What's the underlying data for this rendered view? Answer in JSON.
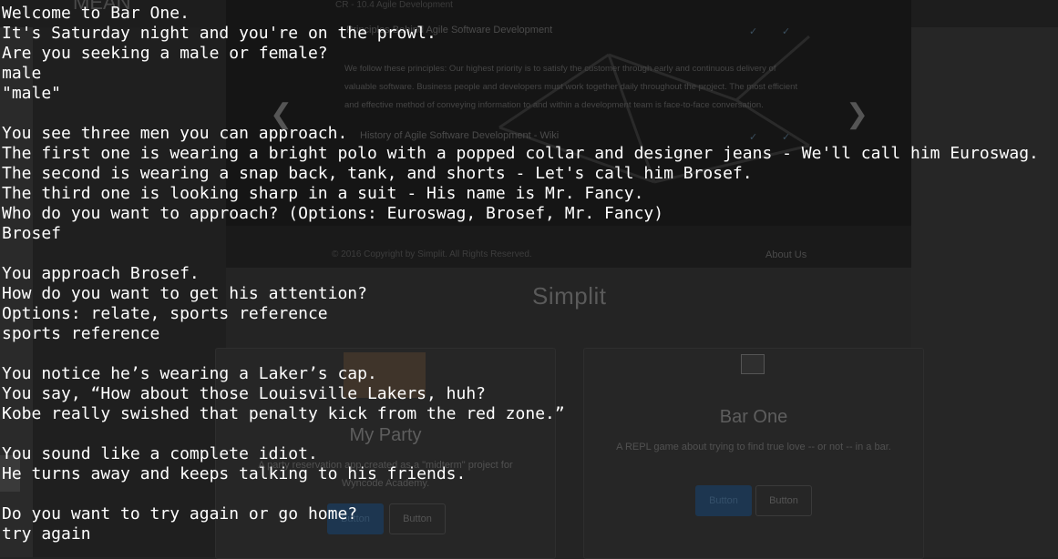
{
  "background": {
    "top_logo": "MEAN",
    "carousel": {
      "small_text": "CR - 10.4 Agile Development",
      "title": "Principles Behind Agile Software Development",
      "body": "We follow these principles: Our highest priority is to satisfy the customer through early and continuous delivery of valuable software. Business people and developers must work together daily throughout the project. The most efficient and effective method of conveying information to and within a development team is face-to-face conversation.",
      "link": "History of Agile Software Development - Wiki",
      "prev_arrow": "❮",
      "next_arrow": "❯",
      "check_mark": "✓"
    },
    "footer": {
      "copyright": "© 2016 Copyright by Simplit. All Rights Reserved.",
      "about": "About Us"
    },
    "brand": "Simplit",
    "cards": [
      {
        "title": "My Party",
        "description": "A party reservation app created as a \"midterm\" project for Wyncode Academy.",
        "buttons": [
          "Button",
          "Button"
        ]
      },
      {
        "title": "Bar One",
        "description": "A REPL game about trying to find true love -- or not -- in a bar.",
        "buttons": [
          "Button",
          "Button"
        ]
      }
    ],
    "colors": {
      "primary_button": "#1d3650"
    }
  },
  "terminal": {
    "lines": [
      "Welcome to Bar One.",
      "It's Saturday night and you're on the prowl.",
      "Are you seeking a male or female?",
      "male",
      "\"male\"",
      "",
      "You see three men you can approach.",
      "The first one is wearing a bright polo with a popped collar and designer jeans - We'll call him Euroswag.",
      "The second is wearing a snap back, tank, and shorts - Let's call him Brosef.",
      "The third one is looking sharp in a suit - His name is Mr. Fancy.",
      "Who do you want to approach? (Options: Euroswag, Brosef, Mr. Fancy)",
      "Brosef",
      "",
      "You approach Brosef.",
      "How do you want to get his attention?",
      "Options: relate, sports reference",
      "sports reference",
      "",
      "You notice he’s wearing a Laker’s cap.",
      "You say, “How about those Louisville Lakers, huh?",
      "Kobe really swished that penalty kick from the red zone.”",
      "",
      "You sound like a complete idiot.",
      "He turns away and keeps talking to his friends.",
      "",
      "Do you want to try again or go home?",
      "try again"
    ]
  }
}
